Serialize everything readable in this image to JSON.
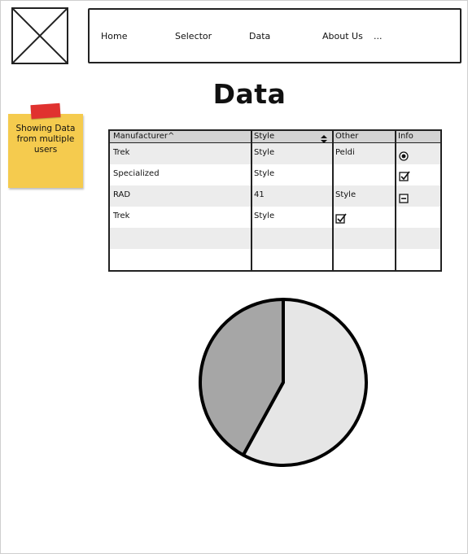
{
  "nav": {
    "items": [
      "Home",
      "Selector",
      "Data",
      "About Us",
      "..."
    ]
  },
  "page": {
    "title": "Data"
  },
  "note": {
    "text": "Showing Data from multiple users"
  },
  "table": {
    "headers": [
      "Manufacturer^",
      "Style",
      "Other",
      "Info"
    ],
    "rows": [
      {
        "manufacturer": "Trek",
        "style": "Style",
        "other": "Peldi",
        "info_icon": "radio-selected-icon"
      },
      {
        "manufacturer": "Specialized",
        "style": "Style",
        "other": "",
        "info_icon": "checkbox-checked-icon"
      },
      {
        "manufacturer": "RAD",
        "style": "41",
        "other": "Style",
        "info_icon": "minus-box-icon"
      },
      {
        "manufacturer": "Trek",
        "style": "Style",
        "other_icon": "checkbox-checked-icon"
      },
      {
        "manufacturer": "",
        "style": "",
        "other": ""
      },
      {
        "manufacturer": "",
        "style": "",
        "other": ""
      }
    ],
    "style_sort_icon": "sort-updown-icon"
  },
  "chart_data": {
    "type": "pie",
    "values": [
      58,
      42
    ],
    "colors": [
      "#e6e6e6",
      "#a6a6a6"
    ],
    "outline": "#000000"
  },
  "colors": {
    "sticky": "#f5cb4e",
    "pin": "#e0322f",
    "header_bg": "#d3d3d3",
    "row_shade": "#ececec"
  }
}
